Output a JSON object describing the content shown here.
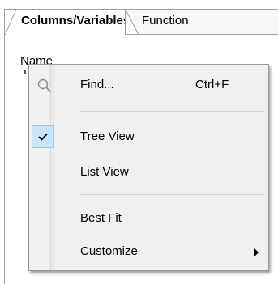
{
  "tabs": [
    {
      "label": "Columns/Variables",
      "active": true
    },
    {
      "label": "Function",
      "active": false
    }
  ],
  "list": {
    "column_header": "Name"
  },
  "context_menu": {
    "items": [
      {
        "label": "Find...",
        "shortcut": "Ctrl+F",
        "icon": "magnifier-icon"
      },
      {
        "label": "Tree View",
        "checked": true
      },
      {
        "label": "List View",
        "checked": false
      },
      {
        "label": "Best Fit"
      },
      {
        "label": "Customize",
        "submenu": true
      }
    ]
  },
  "colors": {
    "menu_bg": "#f0f0f0",
    "check_highlight": "#cce4f7",
    "check_border": "#99c9ef",
    "border": "#a0a0a0"
  }
}
